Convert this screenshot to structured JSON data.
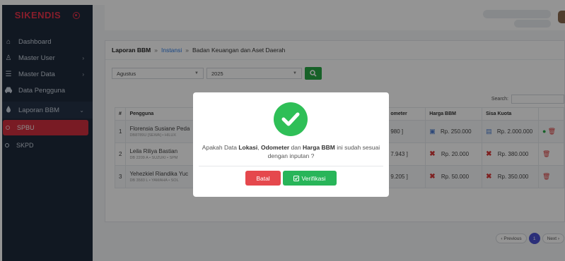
{
  "brand": {
    "name": "SIKENDIS"
  },
  "sidebar": {
    "items": [
      {
        "label": "Dashboard",
        "icon": "home-icon",
        "has_chevron": false
      },
      {
        "label": "Master User",
        "icon": "user-icon",
        "has_chevron": true
      },
      {
        "label": "Master Data",
        "icon": "list-icon",
        "has_chevron": true
      },
      {
        "label": "Data Pengguna",
        "icon": "car-icon",
        "has_chevron": false
      },
      {
        "label": "Laporan BBM",
        "icon": "fuel-icon",
        "has_chevron": true
      }
    ],
    "subitems": [
      {
        "label": "SPBU",
        "active": true
      },
      {
        "label": "SKPD",
        "active": false
      }
    ]
  },
  "breadcrumb": {
    "title": "Laporan BBM",
    "sep1": "»",
    "link": "Instansi",
    "sep2": "»",
    "current": "Badan Keuangan dan Aset Daerah"
  },
  "filters": {
    "month": "Agustus",
    "year": "2025"
  },
  "search": {
    "label": "Search:"
  },
  "table": {
    "headers": [
      "#",
      "Pengguna",
      "",
      "ometer",
      "Harga BBM",
      "Sisa Kuota",
      ""
    ],
    "rows": [
      {
        "no": "1",
        "name": "Florensia Susiane Peda",
        "sub": "DB8789U [SEWA] • HILUX",
        "odometer": "980 ]",
        "harga": "Rp. 250.000",
        "sisa": "Rp. 2.000.000"
      },
      {
        "no": "2",
        "name": "Leila Riliya Bastian",
        "sub": "DB 2209 A • SUZUKI • SPM",
        "odometer": "7.943 ]",
        "harga": "Rp. 20.000",
        "sisa": "Rp. 380.000"
      },
      {
        "no": "3",
        "name": "Yehezkiel Riandika Yuc",
        "sub": "DB 3583 L • YAMAHA • SOL",
        "odometer": "9.205 ]",
        "harga": "Rp. 50.000",
        "sisa": "Rp. 350.000"
      }
    ]
  },
  "pagination": {
    "prev": "‹ Previous",
    "current": "1",
    "next": "Next ›"
  },
  "modal": {
    "msg_a": "Apakah Data ",
    "bold_1": "Lokasi",
    "msg_b": ", ",
    "bold_2": "Odometer",
    "msg_c": " dan ",
    "bold_3": "Harga BBM",
    "msg_d": " ini sudah sesuai dengan inputan ?",
    "cancel_label": "Batal",
    "confirm_label": "Verifikasi"
  },
  "colors": {
    "accent_red": "#e8334a",
    "success": "#28b559",
    "sidebar_bg": "#1e2a3b",
    "pager_active": "#4b52d0"
  }
}
